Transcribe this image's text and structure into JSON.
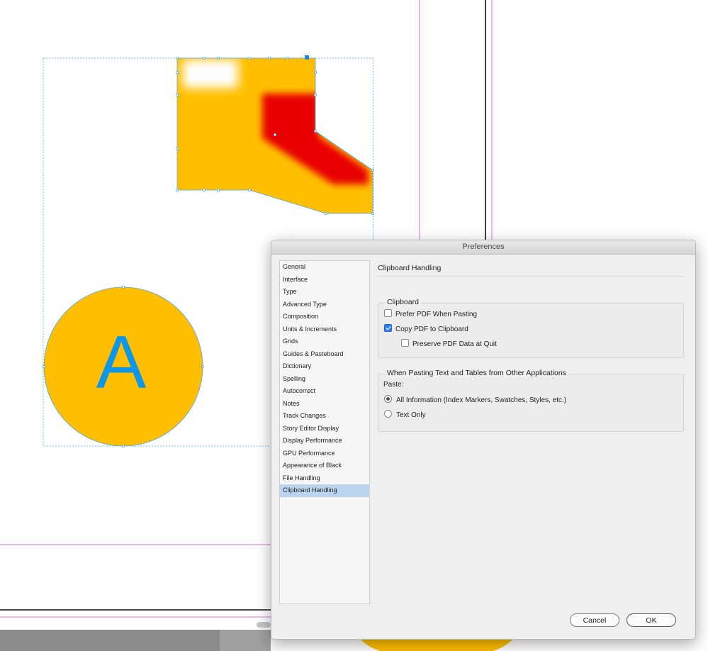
{
  "dialog": {
    "title": "Preferences",
    "sidebar": {
      "items": [
        "General",
        "Interface",
        "Type",
        "Advanced Type",
        "Composition",
        "Units & Increments",
        "Grids",
        "Guides & Pasteboard",
        "Dictionary",
        "Spelling",
        "Autocorrect",
        "Notes",
        "Track Changes",
        "Story Editor Display",
        "Display Performance",
        "GPU Performance",
        "Appearance of Black",
        "File Handling",
        "Clipboard Handling"
      ],
      "selected": "Clipboard Handling"
    },
    "section_title": "Clipboard Handling",
    "clipboard_group": {
      "legend": "Clipboard",
      "prefer_pdf_label": "Prefer PDF When Pasting",
      "prefer_pdf_checked": false,
      "copy_pdf_label": "Copy PDF to Clipboard",
      "copy_pdf_checked": true,
      "preserve_pdf_label": "Preserve PDF Data at Quit",
      "preserve_pdf_checked": false
    },
    "paste_group": {
      "legend": "When Pasting Text and Tables from Other Applications",
      "paste_label": "Paste:",
      "all_info_label": "All Information (Index Markers, Swatches, Styles, etc.)",
      "text_only_label": "Text Only",
      "selected": "All Information (Index Markers, Swatches, Styles, etc.)"
    },
    "cancel_label": "Cancel",
    "ok_label": "OK"
  },
  "canvas": {
    "letter": "A",
    "colors": {
      "artwork_yellow": "#ffbf00",
      "artwork_red": "#e80000",
      "letter_blue": "#0f96e6",
      "selection_blue": "#4aa8e8",
      "guide_magenta": "#e26ee2",
      "page_edge": "#111111"
    }
  }
}
